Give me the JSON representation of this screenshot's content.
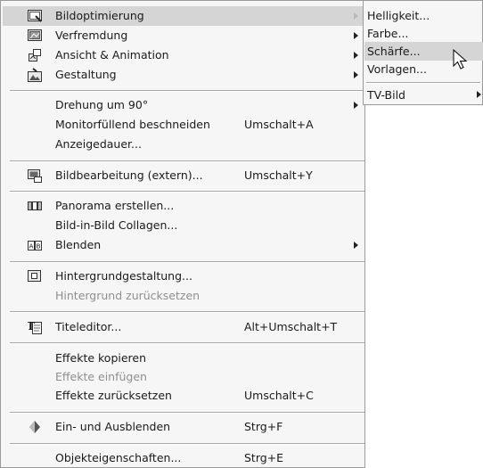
{
  "menu": {
    "bildoptimierung": "Bildoptimierung",
    "verfremdung": "Verfremdung",
    "ansicht_animation": "Ansicht & Animation",
    "gestaltung": "Gestaltung",
    "drehung": "Drehung um 90°",
    "monitorfuellend": "Monitorfüllend beschneiden",
    "monitorfuellend_shortcut": "Umschalt+A",
    "anzeigedauer": "Anzeigedauer...",
    "bildbearbeitung": "Bildbearbeitung (extern)...",
    "bildbearbeitung_shortcut": "Umschalt+Y",
    "panorama": "Panorama erstellen...",
    "bild_in_bild": "Bild-in-Bild Collagen...",
    "blenden": "Blenden",
    "hintergrundgestaltung": "Hintergrundgestaltung...",
    "hintergrund_zuruecksetzen": "Hintergrund zurücksetzen",
    "titeleditor": "Titeleditor...",
    "titeleditor_shortcut": "Alt+Umschalt+T",
    "effekte_kopieren": "Effekte kopieren",
    "effekte_einfuegen": "Effekte einfügen",
    "effekte_zuruecksetzen": "Effekte zurücksetzen",
    "effekte_zuruecksetzen_shortcut": "Umschalt+C",
    "ein_ausblenden": "Ein- und Ausblenden",
    "ein_ausblenden_shortcut": "Strg+F",
    "objekteigenschaften": "Objekteigenschaften...",
    "objekteigenschaften_shortcut": "Strg+E"
  },
  "submenu": {
    "helligkeit": "Helligkeit...",
    "farbe": "Farbe...",
    "schaerfe": "Schärfe...",
    "vorlagen": "Vorlagen...",
    "tv_bild": "TV-Bild"
  },
  "icons": {
    "bildoptimierung": "image-optimize-icon",
    "verfremdung": "image-effect-icon",
    "ansicht_animation": "animation-icon",
    "gestaltung": "design-icon",
    "bildbearbeitung": "external-edit-icon",
    "panorama": "panorama-icon",
    "blenden": "blend-icon",
    "hintergrundgestaltung": "background-icon",
    "titeleditor": "title-editor-icon",
    "ein_ausblenden": "fade-icon"
  },
  "colors": {
    "menu_bg": "#f6f6f6",
    "highlight": "#d5d5d5",
    "disabled_text": "#8f8f8f",
    "separator": "#a8a8a8"
  }
}
